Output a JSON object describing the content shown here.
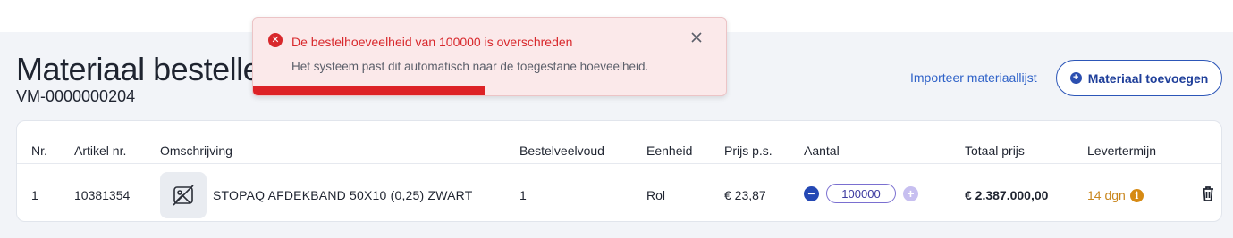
{
  "page": {
    "title": "Materiaal bestellen",
    "order_id": "VM-0000000204",
    "import_link": "Importeer materiaallijst",
    "add_button": "Materiaal toevoegen"
  },
  "table": {
    "headers": {
      "nr": "Nr.",
      "article": "Artikel nr.",
      "description": "Omschrijving",
      "order_multiple": "Bestelveelvoud",
      "unit": "Eenheid",
      "price": "Prijs p.s.",
      "quantity": "Aantal",
      "total": "Totaal prijs",
      "lead_time": "Levertermijn"
    },
    "rows": [
      {
        "nr": "1",
        "article": "10381354",
        "description": "STOPAQ AFDEKBAND 50X10 (0,25) ZWART",
        "order_multiple": "1",
        "unit": "Rol",
        "price": "€ 23,87",
        "quantity": "100000",
        "total": "€ 2.387.000,00",
        "lead_time": "14 dgn"
      }
    ]
  },
  "toast": {
    "title": "De bestelhoeveelheid van 100000 is overschreden",
    "message": "Het systeem past dit automatisch naar de toegestane hoeveelheid.",
    "progress": 0.49
  },
  "colors": {
    "accent": "#2c56b8",
    "error": "#d8282c",
    "lead_time": "#c9871e"
  }
}
